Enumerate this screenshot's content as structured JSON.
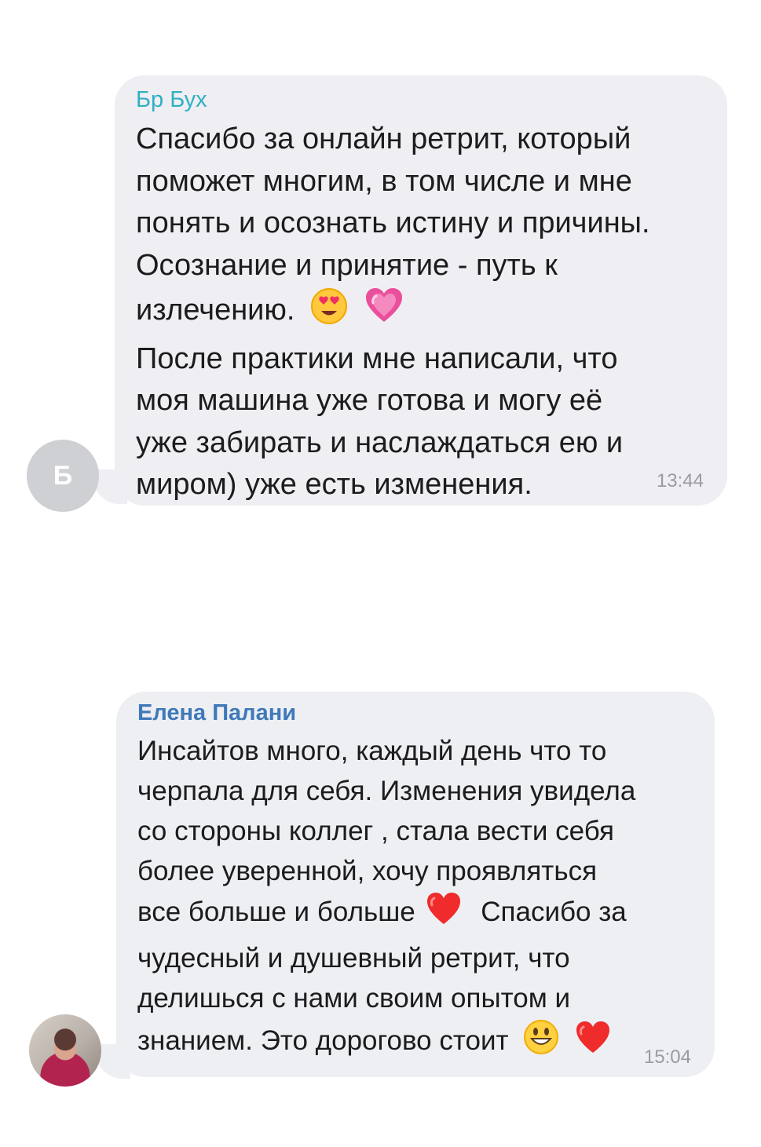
{
  "messages": [
    {
      "sender": "Бр Бух",
      "avatar_initial": "Б",
      "lines": [
        "Спасибо за онлайн ретрит, который",
        "поможет многим, в том числе и мне",
        "понять и осознать истину и причины.",
        "Осознание и принятие - путь к",
        "излечению.",
        "После практики мне  написали, что",
        "моя машина уже готова и могу её",
        "уже забирать и наслаждаться ею и",
        "миром) уже есть изменения."
      ],
      "emojis": [
        "😍",
        "💗"
      ],
      "time": "13:44",
      "colors": {
        "sender": "#2fb0c2",
        "bubble": "#efeff3",
        "avatar": "#cfd0d4"
      }
    },
    {
      "sender": "Елена Палани",
      "avatar": "profile-photo",
      "lines": [
        "Инсайтов много, каждый день что то",
        "черпала для себя. Изменения увидела",
        "со стороны коллег , стала вести себя",
        "более уверенной, хочу проявляться",
        "все больше и больше",
        "Спасибо за",
        "чудесный и душевный ретрит, что",
        "делишься с нами своим опытом и",
        "знанием. Это дорогово стоит"
      ],
      "emojis": [
        "❤️",
        "😃",
        "❤️"
      ],
      "time": "15:04",
      "colors": {
        "sender": "#3f79b9",
        "bubble": "#eeeff3"
      }
    }
  ]
}
